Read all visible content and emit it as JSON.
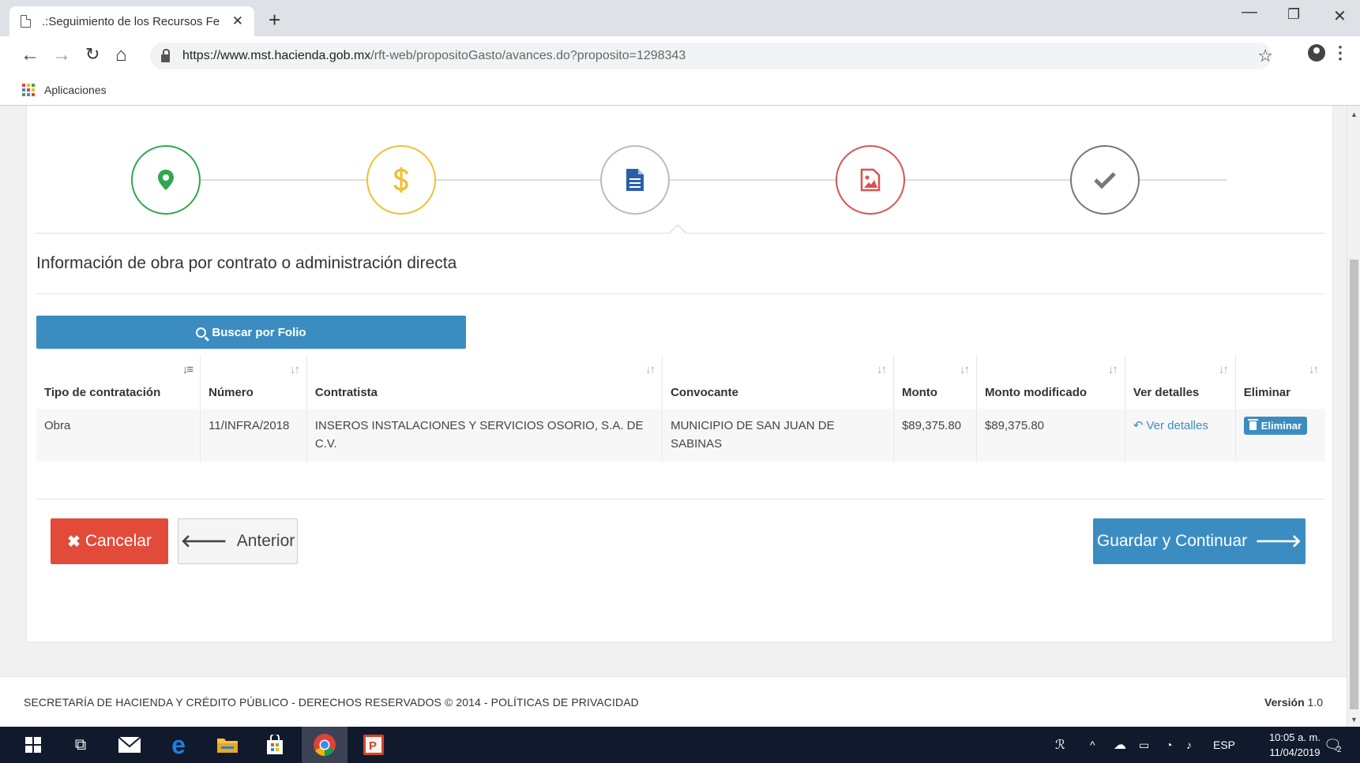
{
  "browser": {
    "tab_title": ".:Seguimiento de los Recursos Fe",
    "url_host": "https://www.mst.hacienda.gob.mx",
    "url_path": "/rft-web/propositoGasto/avances.do?proposito=1298343",
    "bookmark_apps": "Aplicaciones",
    "new_tab": "+",
    "close_tab": "✕",
    "minimize": "—",
    "restore": "❐",
    "close_window": "✕"
  },
  "steps": [
    {
      "name": "location",
      "color": "#2fa84f",
      "icon": "map-marker-icon"
    },
    {
      "name": "money",
      "color": "#f0c030",
      "icon": "dollar-icon"
    },
    {
      "name": "document",
      "color": "#aaaaaa",
      "icon": "file-text-icon",
      "active": true
    },
    {
      "name": "image",
      "color": "#d9534f",
      "icon": "image-icon"
    },
    {
      "name": "finish",
      "color": "#777777",
      "icon": "checkmark-icon"
    }
  ],
  "section": {
    "title": "Información de obra por contrato o administración directa",
    "search_button": "Buscar por Folio"
  },
  "table": {
    "headers": {
      "tipo": "Tipo de contratación",
      "numero": "Número",
      "contratista": "Contratista",
      "convocante": "Convocante",
      "monto": "Monto",
      "monto_modificado": "Monto modificado",
      "ver_detalles": "Ver detalles",
      "eliminar": "Eliminar"
    },
    "rows": [
      {
        "tipo": "Obra",
        "numero": "11/INFRA/2018",
        "contratista": "INSEROS INSTALACIONES Y SERVICIOS OSORIO, S.A. DE C.V.",
        "convocante": "MUNICIPIO DE SAN JUAN DE SABINAS",
        "monto": "$89,375.80",
        "monto_modificado": "$89,375.80",
        "ver_detalles": "Ver detalles",
        "eliminar": "Eliminar"
      }
    ]
  },
  "actions": {
    "cancel": "Cancelar",
    "previous": "Anterior",
    "save_continue": "Guardar y Continuar"
  },
  "footer": {
    "text": "SECRETARÍA DE HACIENDA Y CRÉDITO PÚBLICO - DERECHOS RESERVADOS © 2014 - POLÍTICAS DE PRIVACIDAD",
    "version_label": "Versión",
    "version_value": "1.0"
  },
  "taskbar": {
    "language": "ESP",
    "time": "10:05 a. m.",
    "date": "11/04/2019",
    "notification_count": "2"
  },
  "colors": {
    "primary": "#3b8dc1",
    "danger": "#e24b3a"
  }
}
